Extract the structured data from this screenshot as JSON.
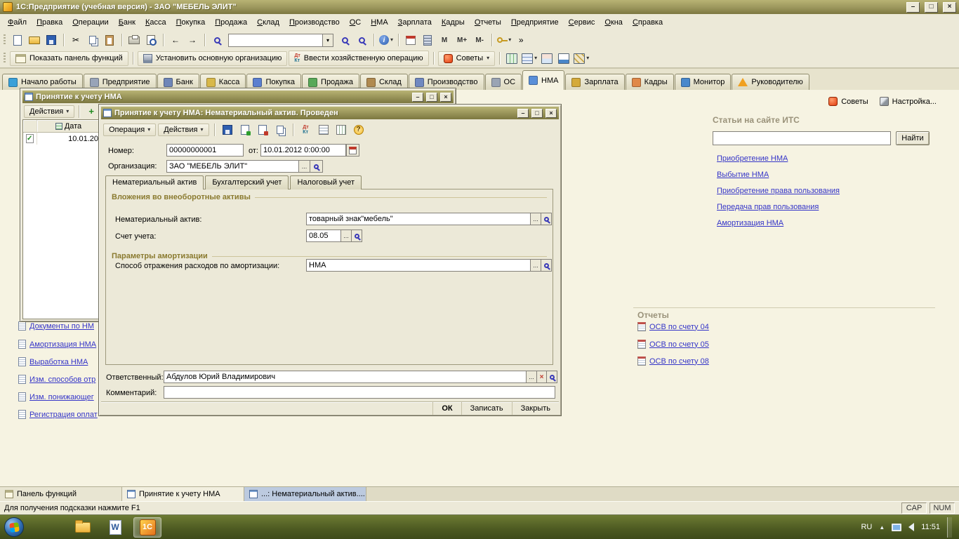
{
  "icons": {
    "dropdown": "▾",
    "minimize": "–",
    "maximize": "□",
    "close": "×",
    "cut": "✂",
    "back": "←",
    "forward": "→",
    "info": "i",
    "help": "?",
    "plus": "+",
    "overflow": "»",
    "ellipsis": "...",
    "clear": "×",
    "dt": "Дт",
    "kt": "Кт",
    "hidden_icons": "▲",
    "word": "W",
    "onec": "1С"
  },
  "titlebar": {
    "title": "1С:Предприятие (учебная версия) - ЗАО \"МЕБЕЛЬ ЭЛИТ\""
  },
  "menu": {
    "items": [
      "Файл",
      "Правка",
      "Операции",
      "Банк",
      "Касса",
      "Покупка",
      "Продажа",
      "Склад",
      "Производство",
      "ОС",
      "НМА",
      "Зарплата",
      "Кадры",
      "Отчеты",
      "Предприятие",
      "Сервис",
      "Окна",
      "Справка"
    ]
  },
  "toolbar1": {
    "search_value": "",
    "memory_buttons": [
      "М",
      "М+",
      "М-"
    ]
  },
  "toolbar2": {
    "show_functions_panel": "Показать панель функций",
    "set_main_org": "Установить основную организацию",
    "enter_business_operation": "Ввести хозяйственную операцию",
    "tips": "Советы"
  },
  "section_tabs": [
    {
      "label": "Начало работы",
      "active": false
    },
    {
      "label": "Предприятие",
      "active": false
    },
    {
      "label": "Банк",
      "active": false
    },
    {
      "label": "Касса",
      "active": false
    },
    {
      "label": "Покупка",
      "active": false
    },
    {
      "label": "Продажа",
      "active": false
    },
    {
      "label": "Склад",
      "active": false
    },
    {
      "label": "Производство",
      "active": false
    },
    {
      "label": "ОС",
      "active": false
    },
    {
      "label": "НМА",
      "active": true
    },
    {
      "label": "Зарплата",
      "active": false
    },
    {
      "label": "Кадры",
      "active": false
    },
    {
      "label": "Монитор",
      "active": false
    },
    {
      "label": "Руководителю",
      "active": false
    }
  ],
  "panel": {
    "tips_button": "Советы",
    "settings_button": "Настройка...",
    "its": {
      "title": "Статьи на сайте ИТС",
      "search_value": "",
      "find_button": "Найти",
      "links": [
        "Приобретение НМА",
        "Выбытие НМА",
        "Приобретение права пользования",
        "Передача прав пользования",
        "Амортизация НМА"
      ]
    },
    "reports": {
      "title": "Отчеты",
      "links": [
        "ОСВ по счету 04",
        "ОСВ по счету 05",
        "ОСВ по счету 08"
      ]
    },
    "sidebar_links": [
      "Документы по НМ",
      "Амортизация НМА",
      "Выработка НМА",
      "Изм. способов отр",
      "Изм. понижающег",
      "Регистрация оплат"
    ]
  },
  "list_window": {
    "title": "Принятие к учету НМА",
    "actions_button": "Действия",
    "add_button": "До",
    "date_column": "Дата",
    "row_date": "10.01.20"
  },
  "dialog": {
    "title": "Принятие к учету НМА: Нематериальный актив. Проведен",
    "operation_menu": "Операция",
    "actions_menu": "Действия",
    "number_label": "Номер:",
    "number_value": "00000000001",
    "from_label": "от:",
    "date_value": "10.01.2012 0:00:00",
    "org_label": "Организация:",
    "org_value": "ЗАО \"МЕБЕЛЬ ЭЛИТ\"",
    "tabs": [
      {
        "label": "Нематериальный актив",
        "active": true
      },
      {
        "label": "Бухгалтерский учет",
        "active": false
      },
      {
        "label": "Налоговый учет",
        "active": false
      }
    ],
    "section_investments": "Вложения во внеоборотные активы",
    "nma_label": "Нематериальный актив:",
    "nma_value": "товарный знак\"мебель\"",
    "account_label": "Счет учета:",
    "account_value": "08.05",
    "section_amortization": "Параметры амортизации",
    "method_label": "Способ отражения расходов по амортизации:",
    "method_value": "НМА",
    "responsible_label": "Ответственный:",
    "responsible_value": "Абдулов Юрий Владимирович",
    "comment_label": "Комментарий:",
    "comment_value": "",
    "ok_button": "ОК",
    "write_button": "Записать",
    "close_button": "Закрыть"
  },
  "window_bar": {
    "items": [
      "Панель функций",
      "Принятие к учету НМА",
      "...: Нематериальный актив...."
    ]
  },
  "statusbar": {
    "hint": "Для получения подсказки нажмите F1",
    "caps_indicator": "CAP",
    "num_indicator": "NUM"
  },
  "os_taskbar": {
    "language": "RU",
    "time": "11:51"
  }
}
